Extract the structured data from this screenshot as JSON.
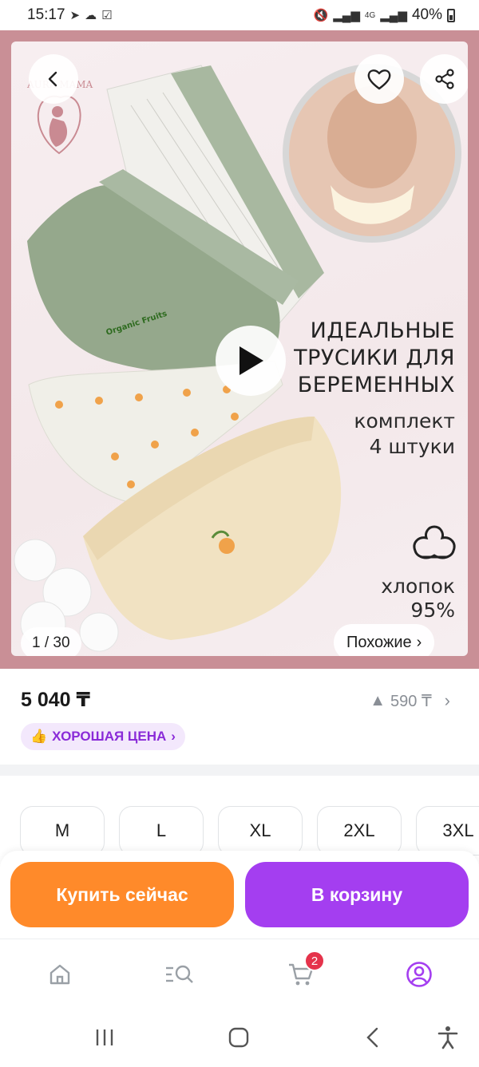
{
  "status_bar": {
    "time": "15:17",
    "network": "4G",
    "battery": "40%"
  },
  "gallery": {
    "brand_logo_text": "AURA MAMA",
    "headline": [
      "ИДЕАЛЬНЫЕ",
      "ТРУСИКИ ДЛЯ",
      "БЕРЕМЕННЫХ"
    ],
    "set_text": [
      "комплект",
      "4 штуки"
    ],
    "cotton_text": [
      "хлопок",
      "95%"
    ],
    "print_text": "Organic Fruits",
    "page_counter": "1 / 30",
    "similar_label": "Похожие",
    "icons": {
      "back": "back-arrow-icon",
      "favorite": "heart-icon",
      "share": "share-icon",
      "play": "play-icon",
      "cotton": "cotton-icon"
    }
  },
  "pricing": {
    "price": "5 040 ₸",
    "price_change": "590 ₸",
    "good_price_label": "ХОРОШАЯ ЦЕНА"
  },
  "sizes": [
    "M",
    "L",
    "XL",
    "2XL",
    "3XL"
  ],
  "actions": {
    "buy_now": "Купить сейчас",
    "add_to_cart": "В корзину"
  },
  "tab_bar": {
    "items": [
      "home-icon",
      "catalog-search-icon",
      "cart-icon",
      "profile-icon"
    ],
    "cart_badge": "2",
    "active_color": "#a43ef0"
  },
  "colors": {
    "frame": "#c98f96",
    "buy_now": "#ff8a2a",
    "add_to_cart": "#a43ef0",
    "good_price_text": "#8a2bd8"
  }
}
